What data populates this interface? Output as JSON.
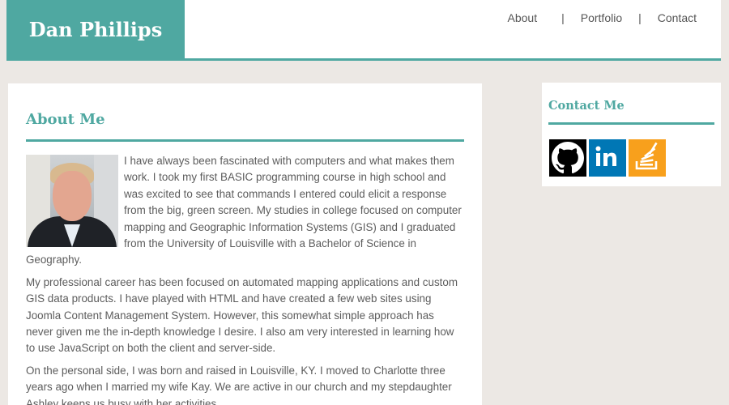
{
  "header": {
    "brand": "Dan Phillips",
    "nav": {
      "about": "About",
      "portfolio": "Portfolio",
      "contact": "Contact",
      "separator": "|"
    }
  },
  "main": {
    "title": "About Me",
    "photo_icon": "profile-photo",
    "paragraphs": [
      "I have always been fascinated with computers and what makes them work. I took my first BASIC programming course in high school and was excited to see that commands I entered could elicit a response from the big, green screen. My studies in college focused on computer mapping and Geographic Information Systems (GIS) and I graduated from the University of Louisville with a Bachelor of Science in Geography.",
      "My professional career has been focused on automated mapping applications and custom GIS data products. I have played with HTML and have created a few web sites using Joomla Content Management System. However, this somewhat simple approach has never given me the in-depth knowledge I desire. I also am very interested in learning how to use JavaScript on both the client and server-side.",
      "On the personal side, I was born and raised in Louisville, KY. I moved to Charlotte three years ago when I married my wife Kay. We are active in our church and my stepdaughter Ashley keeps us busy with her activities."
    ]
  },
  "contact": {
    "title": "Contact Me",
    "icons": [
      "github-icon",
      "linkedin-icon",
      "stackoverflow-icon"
    ]
  },
  "colors": {
    "accent": "#4fa8a1",
    "page_bg": "#ece8e4",
    "linkedin": "#0077b5",
    "stackoverflow": "#f8a01c"
  }
}
